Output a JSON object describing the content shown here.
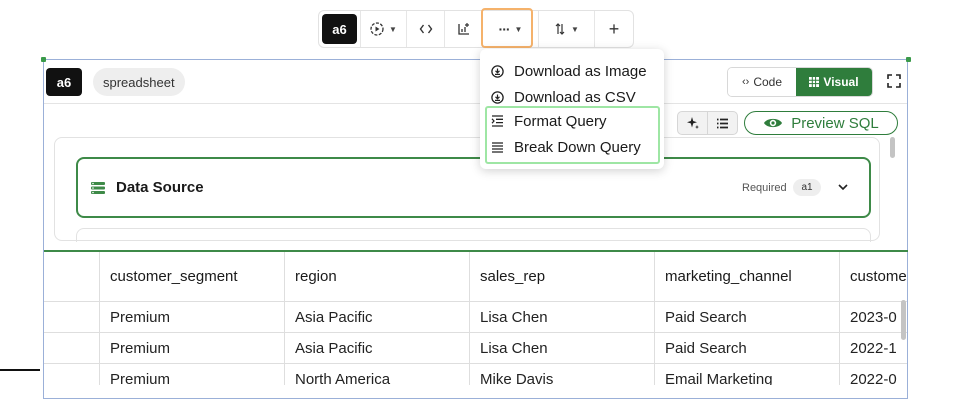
{
  "toolbar": {
    "cell_id": "a6",
    "run_icon": "play-circle-icon",
    "code_icon": "code-brackets-icon",
    "chart_icon": "add-chart-icon",
    "more_icon": "more-horizontal-icon",
    "sort_icon": "sort-arrows-icon",
    "add_icon": "plus-icon",
    "add_label": "+"
  },
  "cell": {
    "id": "a6",
    "type_label": "spreadsheet",
    "code_label": "Code",
    "visual_label": "Visual",
    "fullscreen_icon": "expand-icon"
  },
  "menu": {
    "items": [
      {
        "label": "Download as Image",
        "icon": "download-circle-icon"
      },
      {
        "label": "Download as CSV",
        "icon": "download-circle-icon"
      },
      {
        "label": "Format Query",
        "icon": "indent-icon"
      },
      {
        "label": "Break Down Query",
        "icon": "lines-icon"
      }
    ]
  },
  "query": {
    "preview_label": "Preview SQL",
    "data_source": {
      "title": "Data Source",
      "required_label": "Required",
      "badge": "a1"
    }
  },
  "table": {
    "columns": [
      "customer_segment",
      "region",
      "sales_rep",
      "marketing_channel",
      "custome"
    ],
    "rows": [
      [
        "Premium",
        "Asia Pacific",
        "Lisa Chen",
        "Paid Search",
        "2023-0"
      ],
      [
        "Premium",
        "Asia Pacific",
        "Lisa Chen",
        "Paid Search",
        "2022-1"
      ],
      [
        "Premium",
        "North America",
        "Mike Davis",
        "Email Marketing",
        "2022-0"
      ]
    ]
  },
  "colors": {
    "accent_green": "#2f7d3c",
    "highlight_orange": "#f5b26b",
    "highlight_mint": "#9ee6a4"
  }
}
